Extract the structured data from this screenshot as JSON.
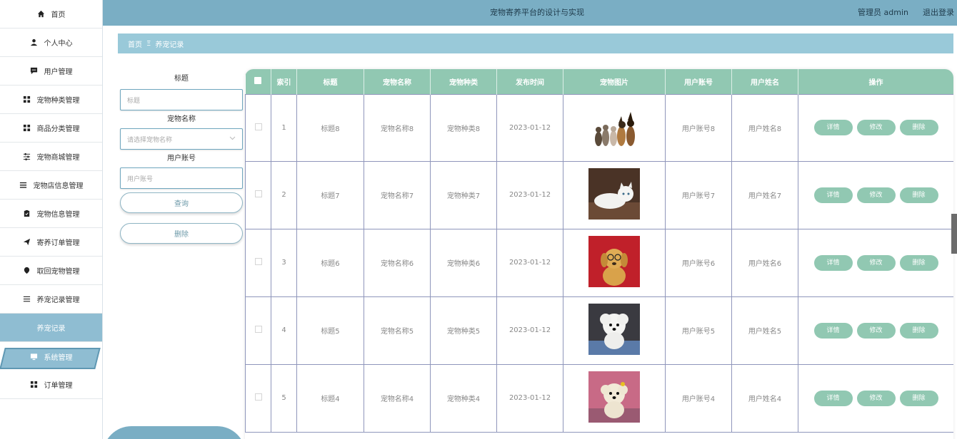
{
  "sidebar": {
    "items": [
      {
        "label": "首页",
        "icon": "home-icon"
      },
      {
        "label": "个人中心",
        "icon": "user-icon"
      },
      {
        "label": "用户管理",
        "icon": "chat-icon"
      },
      {
        "label": "宠物种类管理",
        "icon": "grid-icon"
      },
      {
        "label": "商品分类管理",
        "icon": "grid-icon"
      },
      {
        "label": "宠物商城管理",
        "icon": "sliders-icon"
      },
      {
        "label": "宠物店信息管理",
        "icon": "list-icon"
      },
      {
        "label": "宠物信息管理",
        "icon": "clipboard-icon"
      },
      {
        "label": "寄养订单管理",
        "icon": "send-icon"
      },
      {
        "label": "取回宠物管理",
        "icon": "pin-icon"
      },
      {
        "label": "养宠记录管理",
        "icon": "menu-icon"
      }
    ],
    "sub_item": "养宠记录",
    "system_item": {
      "label": "系统管理",
      "icon": "monitor-icon"
    },
    "order_item": {
      "label": "订单管理",
      "icon": "grid-icon"
    }
  },
  "header": {
    "title": "宠物寄养平台的设计与实现",
    "user": "管理员 admin",
    "logout": "退出登录"
  },
  "breadcrumb": {
    "home": "首页",
    "separator": "Ξ",
    "current": "养宠记录"
  },
  "search": {
    "title_label": "标题",
    "title_placeholder": "标题",
    "pet_name_label": "宠物名称",
    "pet_name_placeholder": "请选择宠物名称",
    "account_label": "用户账号",
    "account_placeholder": "用户账号",
    "query_button": "查询",
    "delete_button": "删除"
  },
  "table": {
    "headers": [
      "索引",
      "标题",
      "宠物名称",
      "宠物种类",
      "发布时间",
      "宠物图片",
      "用户账号",
      "用户姓名",
      "操作"
    ],
    "rows": [
      {
        "index": "1",
        "title": "标题8",
        "pet_name": "宠物名称8",
        "pet_type": "宠物种类8",
        "date": "2023-01-12",
        "account": "用户账号8",
        "name": "用户姓名8"
      },
      {
        "index": "2",
        "title": "标题7",
        "pet_name": "宠物名称7",
        "pet_type": "宠物种类7",
        "date": "2023-01-12",
        "account": "用户账号7",
        "name": "用户姓名7"
      },
      {
        "index": "3",
        "title": "标题6",
        "pet_name": "宠物名称6",
        "pet_type": "宠物种类6",
        "date": "2023-01-12",
        "account": "用户账号6",
        "name": "用户姓名6"
      },
      {
        "index": "4",
        "title": "标题5",
        "pet_name": "宠物名称5",
        "pet_type": "宠物种类5",
        "date": "2023-01-12",
        "account": "用户账号5",
        "name": "用户姓名5"
      },
      {
        "index": "5",
        "title": "标题4",
        "pet_name": "宠物名称4",
        "pet_type": "宠物种类4",
        "date": "2023-01-12",
        "account": "用户账号4",
        "name": "用户姓名4"
      }
    ],
    "actions": {
      "detail": "详情",
      "edit": "修改",
      "delete": "删除"
    }
  },
  "colors": {
    "accent": "#91c8b2",
    "topbar": "#7aaec4",
    "breadcrumb": "#99c9d9"
  }
}
